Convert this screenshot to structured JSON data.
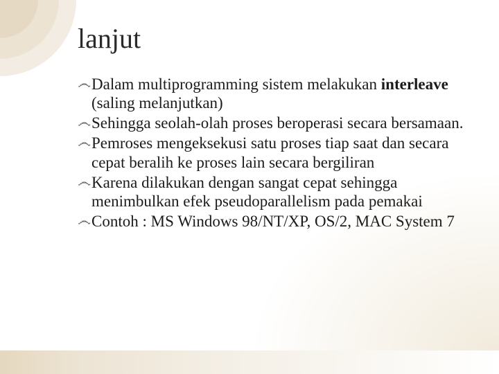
{
  "title": "lanjut",
  "bullet_glyph": "෴",
  "items": [
    {
      "pre": "Dalam multiprogramming sistem melakukan ",
      "bold": "interleave",
      "post": " (saling melanjutkan)"
    },
    {
      "pre": "Sehingga seolah-olah proses beroperasi secara bersamaan.",
      "bold": "",
      "post": ""
    },
    {
      "pre": "Pemroses mengeksekusi satu proses tiap saat dan secara cepat beralih ke proses lain secara bergiliran",
      "bold": "",
      "post": ""
    },
    {
      "pre": "Karena dilakukan dengan sangat cepat sehingga menimbulkan efek pseudoparallelism pada pemakai",
      "bold": "",
      "post": ""
    },
    {
      "pre": "Contoh : MS Windows 98/NT/XP, OS/2, MAC System 7",
      "bold": "",
      "post": ""
    }
  ]
}
